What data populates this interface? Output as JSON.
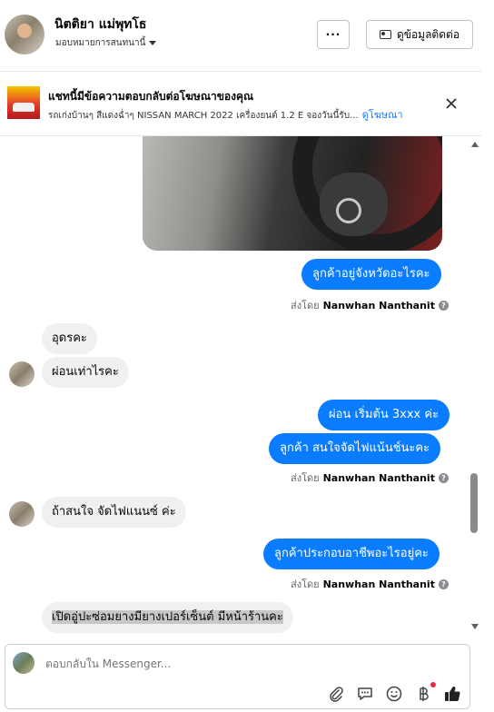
{
  "header": {
    "contact_name": "นิตติยา แม่พุทโธ",
    "assign_label": "มอบหมายการสนทนานี้",
    "more_label": "···",
    "view_contact_label": "ดูข้อมูลติดต่อ"
  },
  "ad_banner": {
    "title": "แชทนี้มีข้อความตอบกลับต่อโฆษณาของคุณ",
    "subtitle": "รถเก่งบ้านๆ สีแดงฉ่ำๆ NISSAN MARCH 2022 เครื่องยนต์ 1.2 E จองวันนี้รับ...",
    "link_label": "ดูโฆษณา"
  },
  "messages": {
    "out1": "ลูกค้าอยู่จังหวัดอะไรคะ",
    "sent1_prefix": "ส่งโดย",
    "sent1_name": "Nanwhan Nanthanit",
    "in1": "อุดรคะ",
    "in2": "ผ่อนเท่าไรคะ",
    "out2": "ผ่อน เริ่มต้น 3xxx ค่ะ",
    "out3": "ลูกค้า สนใจจัดไฟแน้นช์นะคะ",
    "sent2_prefix": "ส่งโดย",
    "sent2_name": "Nanwhan Nanthanit",
    "in3": "ถ้าสนใจ จัดไฟแนนซ์ ค่ะ",
    "out4": "ลูกค้าประกอบอาชีพอะไรอยู่คะ",
    "sent3_prefix": "ส่งโดย",
    "sent3_name": "Nanwhan Nanthanit",
    "in4": "เปิดอู่ปะซ่อมยางมียางเปอร์เซ็นต์ มีหน้าร้านคะ"
  },
  "composer": {
    "placeholder": "ตอบกลับใน Messenger..."
  },
  "icons": {
    "attach": "paperclip-icon",
    "saved_reply": "chat-bubble-icon",
    "emoji": "smiley-icon",
    "payment": "baht-icon",
    "like": "thumbs-up-icon"
  },
  "colors": {
    "outgoing_bubble": "#0a7cff",
    "incoming_bubble": "#f0f0f0",
    "link": "#1877f2"
  }
}
